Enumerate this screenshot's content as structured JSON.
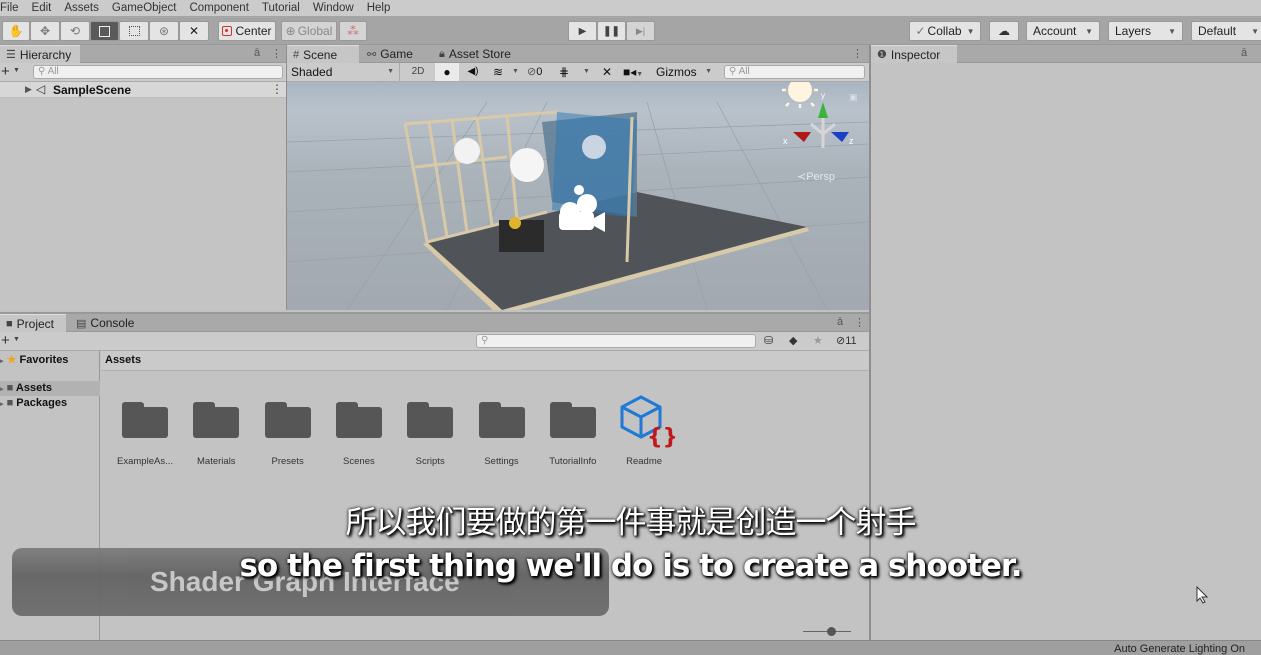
{
  "menu": [
    "File",
    "Edit",
    "Assets",
    "GameObject",
    "Component",
    "Tutorial",
    "Window",
    "Help"
  ],
  "toolbar": {
    "tools": [
      "hand-tool",
      "move-tool",
      "rotate-tool",
      "scale-tool",
      "rect-tool",
      "transform-tool",
      "custom-tool"
    ],
    "pivot_label": "Center",
    "space_label": "Global",
    "collab_label": "Collab",
    "account_label": "Account",
    "layers_label": "Layers",
    "layout_label": "Default"
  },
  "hierarchy": {
    "tab_label": "Hierarchy",
    "search_placeholder": "All",
    "scene_name": "SampleScene"
  },
  "scene": {
    "tabs": [
      "Scene",
      "Game",
      "Asset Store"
    ],
    "shading_mode": "Shaded",
    "mode_2d": "2D",
    "hidden_count": "0",
    "gizmos_label": "Gizmos",
    "search_placeholder": "All",
    "projection_label": "Persp",
    "axis_x": "x",
    "axis_y": "y",
    "axis_z": "z"
  },
  "inspector": {
    "tab_label": "Inspector"
  },
  "project": {
    "tabs": [
      "Project",
      "Console"
    ],
    "hidden_count": "11",
    "tree": {
      "favorites": "Favorites",
      "assets": "Assets",
      "packages": "Packages"
    },
    "breadcrumb": "Assets",
    "items": [
      {
        "name": "ExampleAs...",
        "type": "folder"
      },
      {
        "name": "Materials",
        "type": "folder"
      },
      {
        "name": "Presets",
        "type": "folder"
      },
      {
        "name": "Scenes",
        "type": "folder"
      },
      {
        "name": "Scripts",
        "type": "folder"
      },
      {
        "name": "Settings",
        "type": "folder"
      },
      {
        "name": "TutorialInfo",
        "type": "folder"
      },
      {
        "name": "Readme",
        "type": "readme-asset"
      }
    ]
  },
  "overlay": {
    "banner_text": "Shader Graph Interface",
    "subtitle_zh": "所以我们要做的第一件事就是创造一个射手",
    "subtitle_en": "so the first thing we'll do is to create a shooter."
  },
  "statusbar": {
    "text": "Auto Generate Lighting On"
  },
  "colors": {
    "readme_blue": "#1e7ad6",
    "readme_red": "#c0191d",
    "axis_x": "#b01818",
    "axis_y": "#3cb43c",
    "axis_z": "#1a3fc8"
  }
}
